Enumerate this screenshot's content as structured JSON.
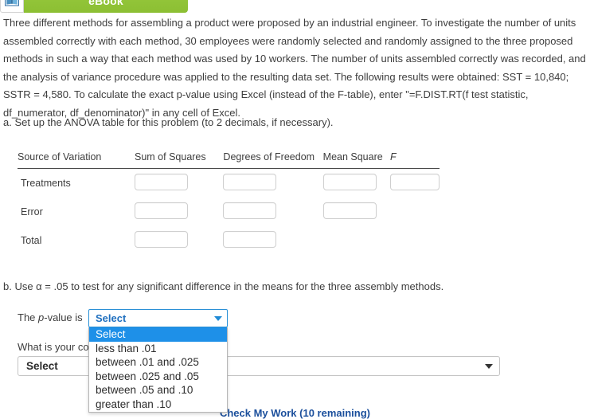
{
  "toolbar": {
    "ebook_label": "eBook",
    "ebook_icon": "book-icon",
    "ebook_color": "#8cbf33"
  },
  "statement": {
    "text": "Three different methods for assembling a product were proposed by an industrial engineer. To investigate the number of units assembled correctly with each method, 30 employees were randomly selected and randomly assigned to the three proposed methods in such a way that each method was used by 10 workers. The number of units assembled correctly was recorded, and the analysis of variance procedure was applied to the resulting data set. The following results were obtained: SST = 10,840; SSTR = 4,580. To calculate the exact p-value using Excel (instead of the F-table), enter \"=F.DIST.RT(f test statistic, df_numerator, df_denominator)\" in any cell of Excel."
  },
  "part_a": {
    "prompt": "a. Set up the ANOVA table for this problem (to 2 decimals, if necessary).",
    "table": {
      "headers": [
        "Source of Variation",
        "Sum of Squares",
        "Degrees of Freedom",
        "Mean Square",
        "F"
      ],
      "rows": [
        {
          "label": "Treatments",
          "inputs": [
            "",
            "",
            "",
            ""
          ]
        },
        {
          "label": "Error",
          "inputs": [
            "",
            "",
            ""
          ]
        },
        {
          "label": "Total",
          "inputs": [
            "",
            ""
          ]
        }
      ]
    }
  },
  "part_b": {
    "prompt": "b. Use α = .05 to test for any significant difference in the means for the three assembly methods.",
    "pvalue_label_prefix": "The ",
    "pvalue_label_italic": "p",
    "pvalue_label_suffix": "-value is",
    "pvalue_select": {
      "value": "Select",
      "expanded": true,
      "options": [
        "Select",
        "less than .01",
        "between .01 and .025",
        "between .025 and .05",
        "between .05 and .10",
        "greater than .10"
      ],
      "selected_index": 0,
      "highlight_color": "#1e90e8",
      "border_color": "#2a90d6",
      "value_color": "#1f6fbf"
    },
    "conclusion_label": "What is your conclusion?",
    "conclusion_select": {
      "value": "Select"
    }
  },
  "footer": {
    "check_my_work": "Check My Work (10 remaining)",
    "link_color": "#1b4f9c"
  }
}
